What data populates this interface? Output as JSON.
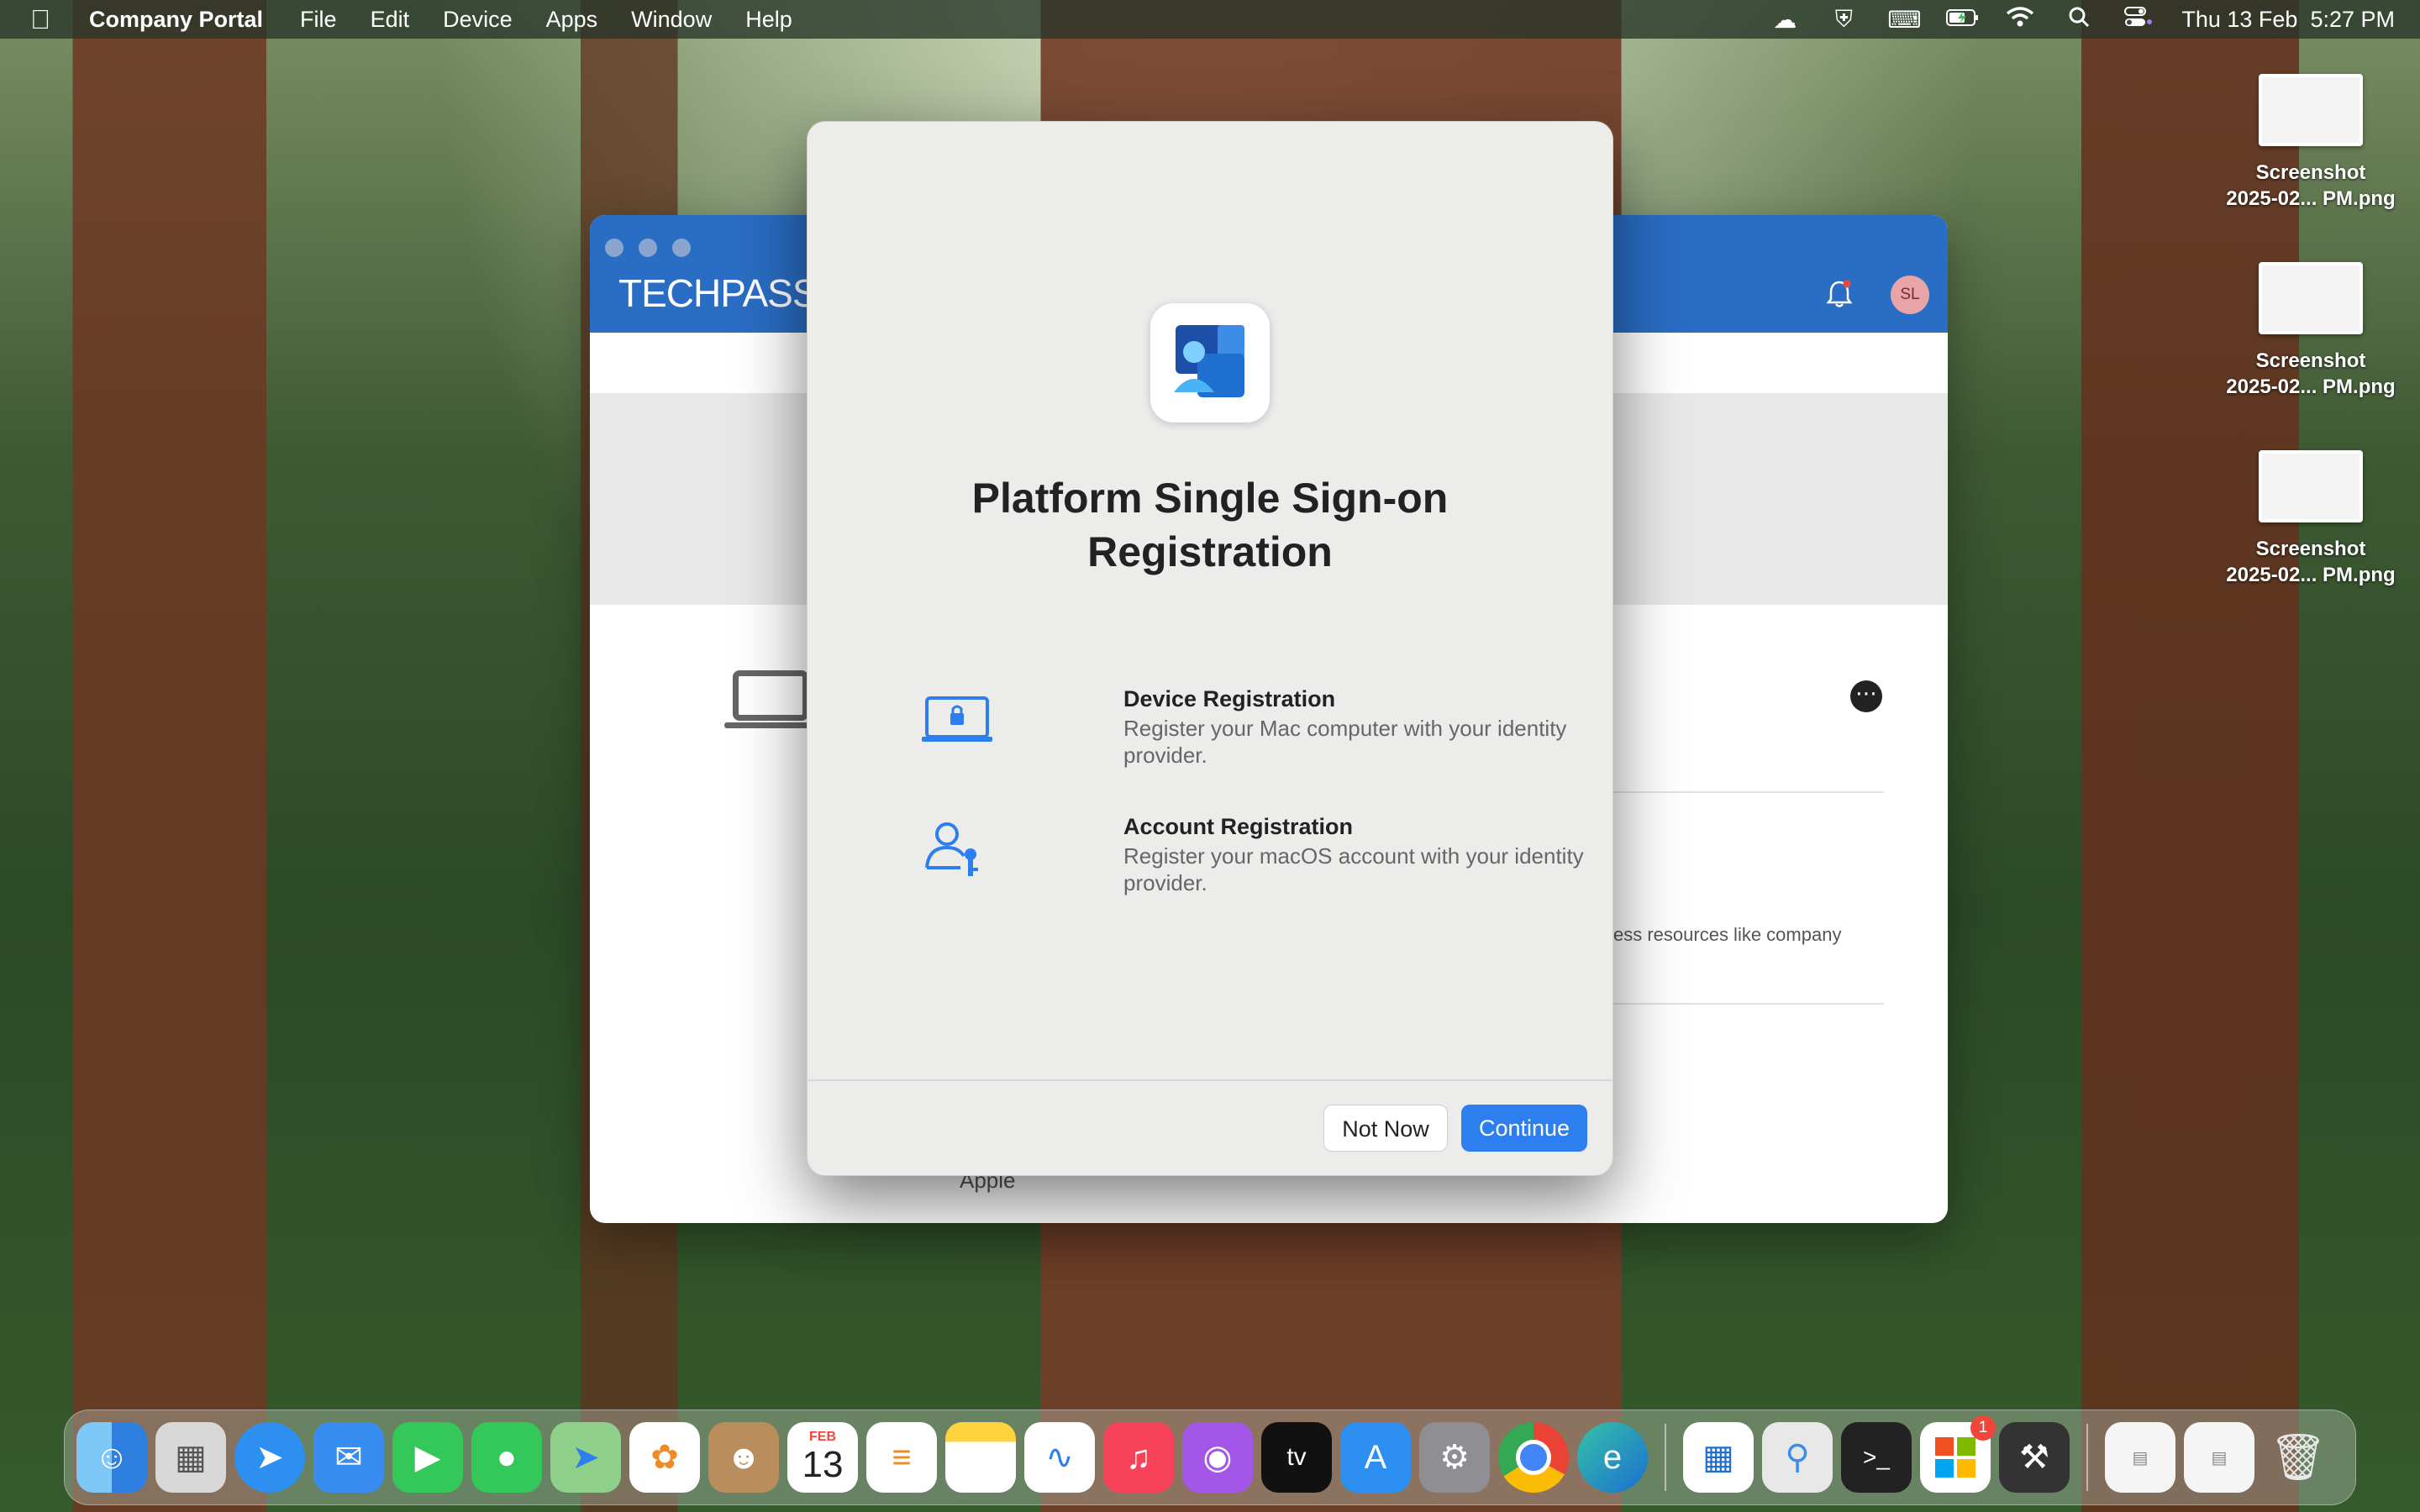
{
  "menubar": {
    "app_name": "Company Portal",
    "menus": [
      "File",
      "Edit",
      "Device",
      "Apps",
      "Window",
      "Help"
    ],
    "status_icons": [
      "cloud-icon",
      "shield-icon",
      "keyboard-icon",
      "battery-charging-icon",
      "wifi-icon",
      "search-icon",
      "control-center-icon"
    ],
    "clock": "Thu 13 Feb  5:27 PM"
  },
  "background_window": {
    "brand": "TECHPASS",
    "avatar_initials": "SL",
    "partial_text": "ess resources like company",
    "apple_text": "Apple"
  },
  "dialog": {
    "title_line1": "Platform Single Sign-on",
    "title_line2": "Registration",
    "options": [
      {
        "title": "Device Registration",
        "description": "Register your Mac computer with your identity provider.",
        "icon": "laptop-lock-icon"
      },
      {
        "title": "Account Registration",
        "description": "Register your macOS account with your identity provider.",
        "icon": "user-key-icon"
      }
    ],
    "buttons": {
      "not_now": "Not Now",
      "continue": "Continue"
    },
    "accent_color": "#2d7ff0"
  },
  "desktop_files": [
    {
      "line1": "Screenshot",
      "line2": "2025-02... PM.png"
    },
    {
      "line1": "Screenshot",
      "line2": "2025-02... PM.png"
    },
    {
      "line1": "Screenshot",
      "line2": "2025-02... PM.png"
    }
  ],
  "dock": {
    "calendar_month": "FEB",
    "calendar_day": "13",
    "badge_count": "1",
    "tv_label": "tv"
  }
}
